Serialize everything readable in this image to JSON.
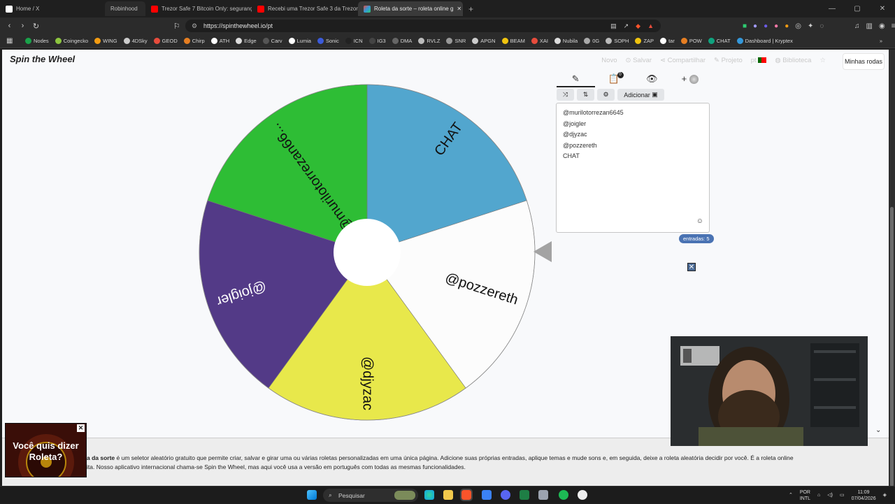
{
  "browser": {
    "tabs": [
      {
        "label": "Home / X",
        "color": "#000000"
      },
      {
        "label": "Robinhood",
        "color": "#1f1f1f"
      },
      {
        "label": "Trezor Safe 7 Bitcoin Only: segurança",
        "color": "#ff0000"
      },
      {
        "label": "Recebi uma Trezor Safe 3 da Trezor, e",
        "color": "#ff0000"
      },
      {
        "label": "Roleta da sorte – roleta online g",
        "color": "#9b59b6",
        "active": true
      }
    ],
    "url": "https://spinthewheel.io/pt",
    "bookmarks": [
      {
        "label": "Nodes",
        "color": "#1aa34a"
      },
      {
        "label": "Coingecko",
        "color": "#8dc63f"
      },
      {
        "label": "WING",
        "color": "#f39c12"
      },
      {
        "label": "4DSky",
        "color": "#cccccc"
      },
      {
        "label": "GEOD",
        "color": "#e74c3c"
      },
      {
        "label": "Chirp",
        "color": "#e67e22"
      },
      {
        "label": "ATH",
        "color": "#ffffff"
      },
      {
        "label": "Edge",
        "color": "#dddddd"
      },
      {
        "label": "Carv",
        "color": "#555555"
      },
      {
        "label": "Lumia",
        "color": "#ffffff"
      },
      {
        "label": "Sonic",
        "color": "#3b5bdb"
      },
      {
        "label": "ICN",
        "color": "#222222"
      },
      {
        "label": "IG3",
        "color": "#444444"
      },
      {
        "label": "DMA",
        "color": "#666666"
      },
      {
        "label": "RVLZ",
        "color": "#bbbbbb"
      },
      {
        "label": "SNR",
        "color": "#999999"
      },
      {
        "label": "APGN",
        "color": "#cccccc"
      },
      {
        "label": "BEAM",
        "color": "#f1c40f"
      },
      {
        "label": "XAI",
        "color": "#e74c3c"
      },
      {
        "label": "Nubila",
        "color": "#dddddd"
      },
      {
        "label": "0G",
        "color": "#aaaaaa"
      },
      {
        "label": "SOPH",
        "color": "#bbbbbb"
      },
      {
        "label": "ZAP",
        "color": "#f1c40f"
      },
      {
        "label": "tar",
        "color": "#ffffff"
      },
      {
        "label": "POW",
        "color": "#e67e22"
      },
      {
        "label": "CHAT",
        "color": "#10a37f"
      },
      {
        "label": "Dashboard | Kryptex",
        "color": "#3498db"
      }
    ]
  },
  "site": {
    "logo": "Spin the Wheel",
    "nav": [
      "Novo",
      "Salvar",
      "Compartilhar",
      "Projeto",
      "pt",
      "Biblioteca"
    ],
    "my_wheels": "Minhas rodas"
  },
  "wheel": {
    "segments": [
      {
        "label": "CHAT",
        "color": "#52a6ce"
      },
      {
        "label": "@pozzereth",
        "color": "#fcfcfc"
      },
      {
        "label": "@djyzac",
        "color": "#e8e84b"
      },
      {
        "label": "@joigler",
        "color": "#533a87"
      },
      {
        "label": "@murilotorrezan66...",
        "color": "#2ebd35"
      }
    ]
  },
  "panel": {
    "add_button": "Adicionar",
    "entries": [
      "@murilotorrezan6645",
      "@joigler",
      "@djyzac",
      "@pozzereth",
      "CHAT"
    ],
    "count_label": "entradas: 5",
    "clipboard_badge": "0"
  },
  "description": {
    "bold": "a da sorte",
    "text": " é um seletor aleatório gratuito que permite criar, salvar e girar uma ou várias roletas personalizadas em uma única página. Adicione suas próprias entradas, aplique temas e mude sons e, em seguida, deixe a roleta aleatória decidir por você. É a roleta online",
    "text2": "ita. Nosso aplicativo internacional chama-se Spin the Wheel, mas aqui você usa a versão em português com todas as mesmas funcionalidades."
  },
  "ad": {
    "line1": "Você quis dizer",
    "line2": "Roleta?"
  },
  "taskbar": {
    "search": "Pesquisar",
    "lang1": "POR",
    "lang2": "INTL",
    "time": "11:09",
    "date": "07/04/2026"
  }
}
